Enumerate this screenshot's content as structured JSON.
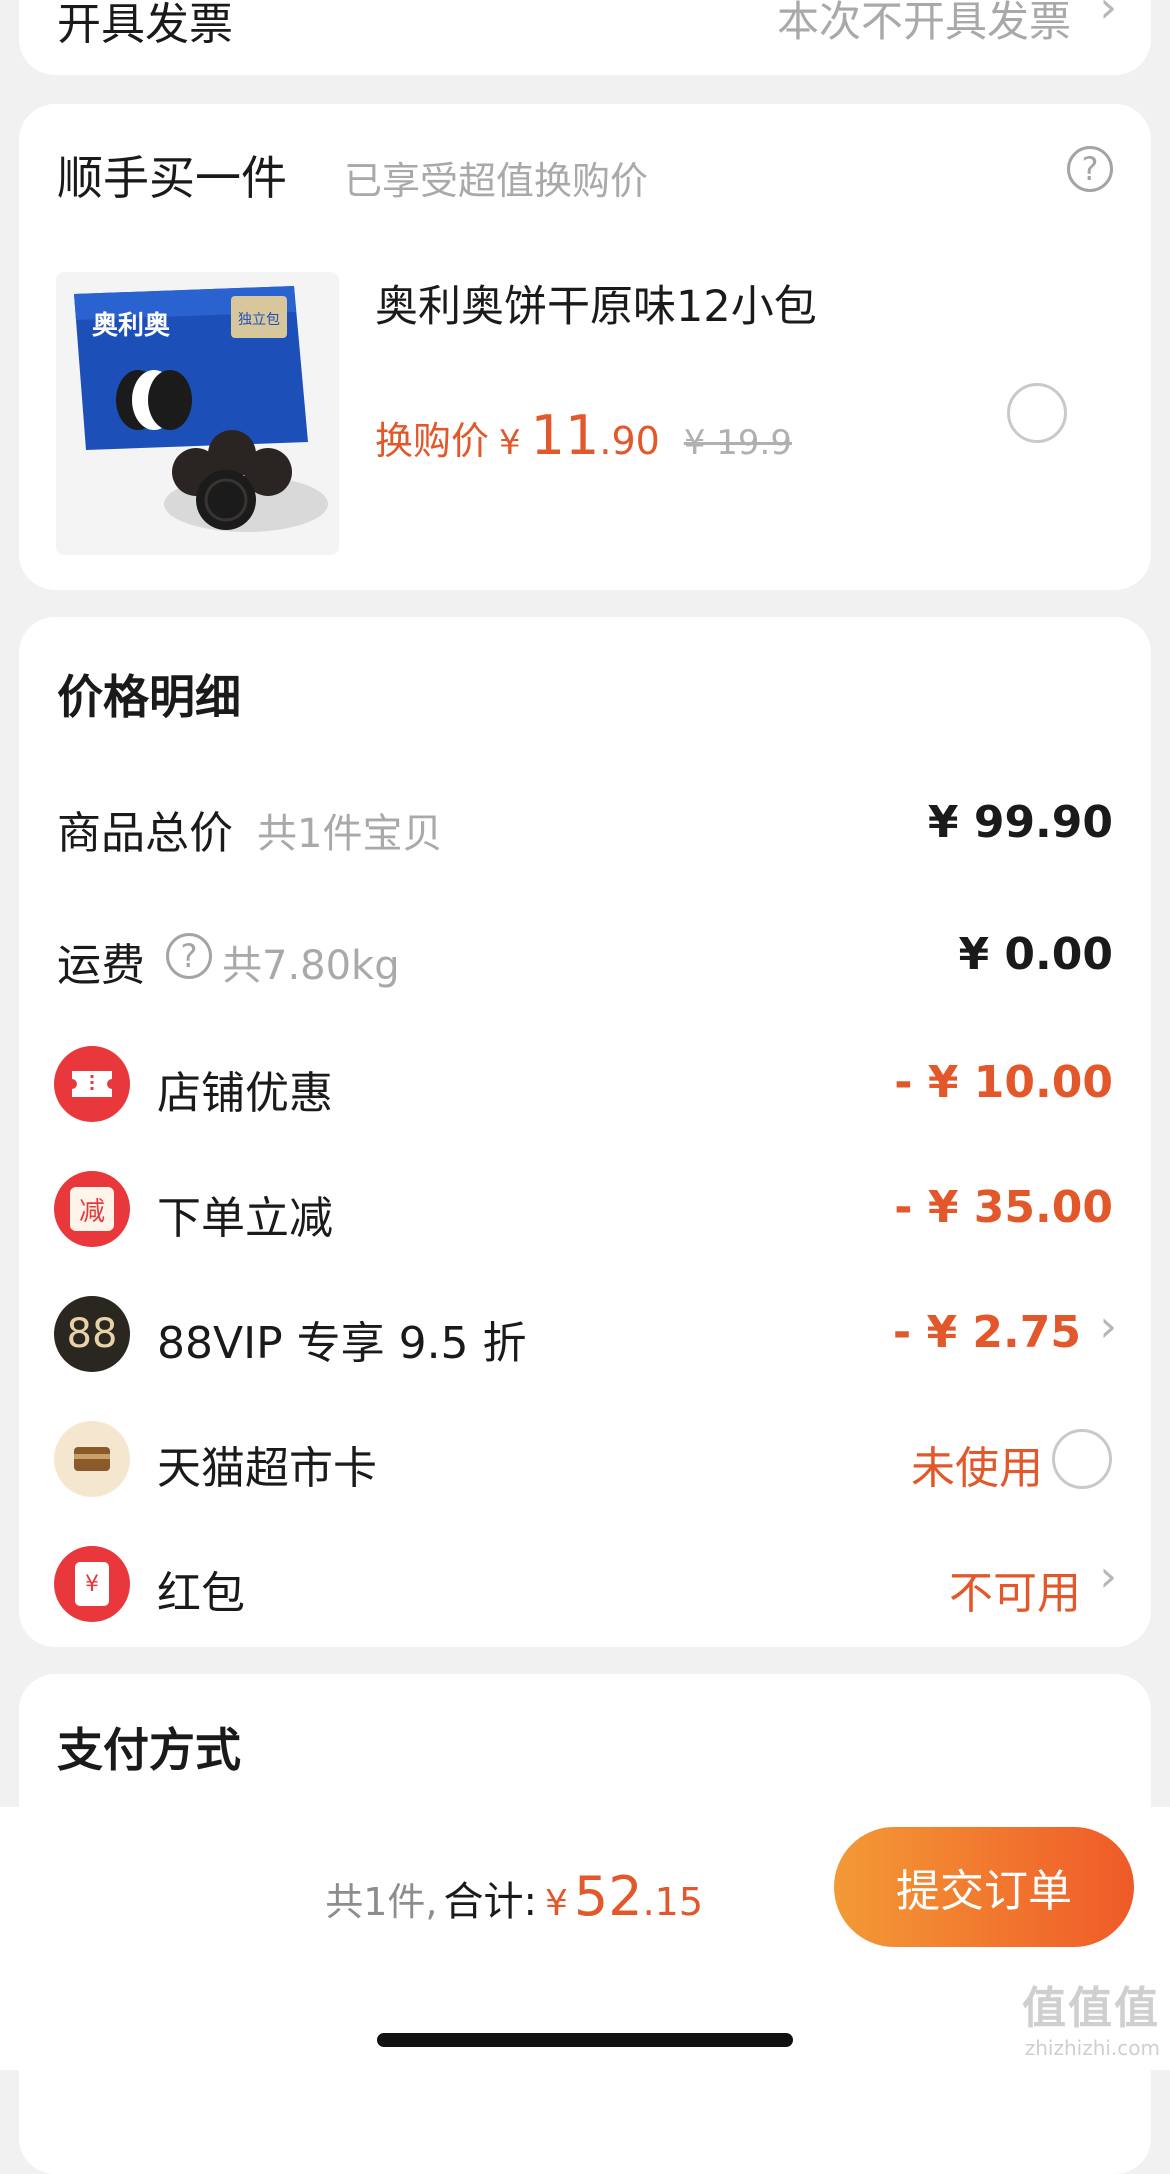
{
  "invoice": {
    "label": "开具发票",
    "value": "本次不开具发票"
  },
  "addon": {
    "title": "顺手买一件",
    "subtitle": "已享受超值换购价",
    "help_glyph": "?",
    "product": {
      "name": "奥利奥饼干原味12小包",
      "price_label": "换购价",
      "currency": "¥",
      "price_int": "11",
      "price_dec": ".90",
      "original_price": "¥ 19.9",
      "thumb_brand": "奥利奥",
      "thumb_tag": "独立包"
    }
  },
  "price_detail": {
    "title": "价格明细",
    "rows": [
      {
        "label": "商品总价",
        "sub": "共1件宝贝",
        "value": "¥ 99.90"
      },
      {
        "label": "运费",
        "sub": "共7.80kg",
        "value": "¥ 0.00"
      },
      {
        "label": "店铺优惠",
        "value": "- ¥ 10.00",
        "icon": "ticket-icon"
      },
      {
        "label": "下单立减",
        "value": "- ¥ 35.00",
        "icon": "discount-icon",
        "icon_text": "减"
      },
      {
        "label": "88VIP 专享 9.5 折",
        "value": "- ¥ 2.75",
        "icon": "vip88-icon",
        "icon_text": "88"
      },
      {
        "label": "天猫超市卡",
        "value": "未使用",
        "icon": "card-icon"
      },
      {
        "label": "红包",
        "value": "不可用",
        "icon": "red-packet-icon",
        "icon_text": "¥"
      }
    ],
    "colors": {
      "accent": "#e2582a",
      "icon_red": "#e8383b",
      "vip_dark": "#2a2620"
    }
  },
  "payment": {
    "title": "支付方式"
  },
  "bottom": {
    "count": "共1件,",
    "total_label": "合计:",
    "currency": "¥",
    "total_int": "52",
    "total_dec": ".15",
    "submit": "提交订单",
    "watermark": "值值值",
    "watermark_url": "zhizhizhi.com"
  }
}
